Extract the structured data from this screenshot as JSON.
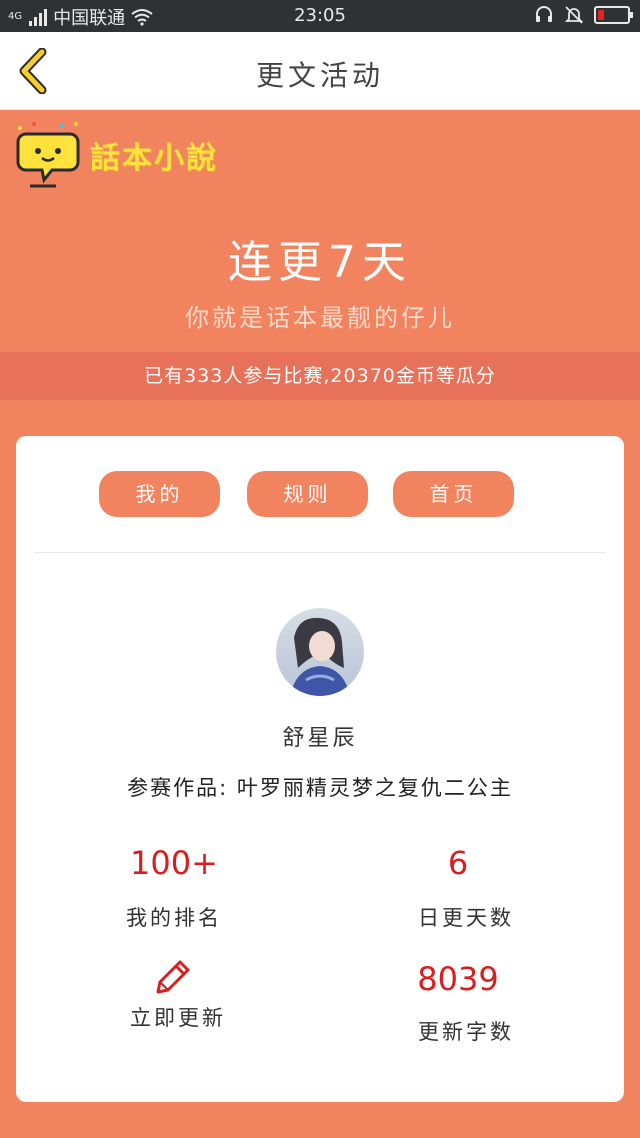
{
  "status_bar": {
    "network_tag": "4G",
    "carrier": "中国联通",
    "time": "23:05",
    "icons": [
      "signal-icon",
      "wifi-icon",
      "headset-icon",
      "mute-icon",
      "battery-icon"
    ],
    "battery_level": 0.15
  },
  "header": {
    "title": "更文活动",
    "back_icon": "chevron-left-icon",
    "back_color": "#f5cf26"
  },
  "banner": {
    "logo_text": "話本小說",
    "title": "连更7天",
    "subtitle": "你就是话本最靓的仔儿",
    "notice": "已有333人参与比赛,20370金币等瓜分"
  },
  "tabs": [
    {
      "label": "我的"
    },
    {
      "label": "规则"
    },
    {
      "label": "首页"
    }
  ],
  "profile": {
    "name": "舒星辰",
    "entry": "参赛作品: 叶罗丽精灵梦之复仇二公主"
  },
  "stats": {
    "rank_value": "100+",
    "rank_label": "我的排名",
    "days_value": "6",
    "days_label": "日更天数",
    "update_label": "立即更新",
    "words_value": "8039",
    "words_label": "更新字数"
  },
  "colors": {
    "accent": "#f2835f",
    "notice_bg": "#e8715a",
    "stat_red": "#d81e1e",
    "logo_yellow": "#ffe23b"
  }
}
